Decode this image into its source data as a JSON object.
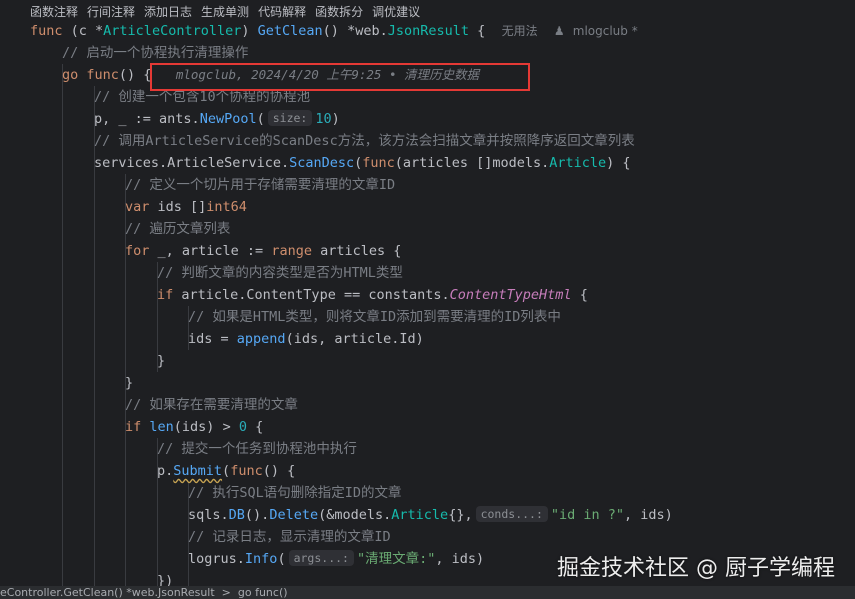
{
  "toolbar": {
    "items": [
      "函数注释",
      "行间注释",
      "添加日志",
      "生成单测",
      "代码解释",
      "函数拆分",
      "调优建议"
    ]
  },
  "code": {
    "l1": {
      "func": "func",
      "recv": "(c *",
      "type": "ArticleController",
      "close": ")",
      "name": "GetClean",
      "paren": "()",
      "star": "*",
      "pkg": "web",
      "dot": ".",
      "rtype": "JsonResult",
      "brace": "{",
      "usage": "无用法",
      "author": "mlogclub *"
    },
    "l2": "// 启动一个协程执行清理操作",
    "l3": {
      "go": "go",
      "func": "func",
      "rest": "() {",
      "blame": "mlogclub, 2024/4/20 上午9:25 • 清理历史数据"
    },
    "l4": "// 创建一个包含10个协程的协程池",
    "l5": {
      "a": "p, _ := ",
      "pkg": "ants",
      "dot": ".",
      "fn": "NewPool",
      "open": "(",
      "hint": "size:",
      "num": "10",
      "close": ")"
    },
    "l6": "// 调用ArticleService的ScanDesc方法，该方法会扫描文章并按照降序返回文章列表",
    "l7": {
      "pkg": "services",
      "dot1": ".",
      "svc": "ArticleService",
      "dot2": ".",
      "fn": "ScanDesc",
      "open": "(",
      "func": "func",
      "args": "(articles []",
      "mpkg": "models",
      "dot3": ".",
      "type": "Article",
      "rest": ") {"
    },
    "l8": "// 定义一个切片用于存储需要清理的文章ID",
    "l9": {
      "var": "var",
      "ids": " ids []",
      "type": "int64"
    },
    "l10": "// 遍历文章列表",
    "l11": {
      "for": "for",
      "mid": " _, article := ",
      "range": "range",
      "rest": " articles {"
    },
    "l12": "// 判断文章的内容类型是否为HTML类型",
    "l13": {
      "if": "if",
      "mid": " article.ContentType == ",
      "pkg": "constants",
      "dot": ".",
      "const": "ContentTypeHtml",
      "rest": " {"
    },
    "l14": "// 如果是HTML类型，则将文章ID添加到需要清理的ID列表中",
    "l15": {
      "a": "ids = ",
      "fn": "append",
      "rest": "(ids, article.Id)"
    },
    "l16": "}",
    "l17": "}",
    "l18": "// 如果存在需要清理的文章",
    "l19": {
      "if": "if",
      "fn": "len",
      "mid": "(ids) > ",
      "num": "0",
      "rest": " {"
    },
    "l20": "// 提交一个任务到协程池中执行",
    "l21": {
      "a": "p.",
      "fn": "Submit",
      "open": "(",
      "func": "func",
      "rest": "() {"
    },
    "l22": "// 执行SQL语句删除指定ID的文章",
    "l23": {
      "pkg": "sqls",
      "dot": ".",
      "fn1": "DB",
      "mid": "().",
      "fn2": "Delete",
      "open": "(&",
      "mpkg": "models",
      "dot2": ".",
      "type": "Article",
      "braces": "{},",
      "hint": "conds...:",
      "str": "\"id in ?\"",
      "rest": ", ids)"
    },
    "l24": "// 记录日志，显示清理的文章ID",
    "l25": {
      "pkg": "logrus",
      "dot": ".",
      "fn": "Info",
      "open": "(",
      "hint": "args...:",
      "str": "\"清理文章:\"",
      "rest": ", ids)"
    },
    "l26": "})"
  },
  "statusbar": "eController.GetClean() *web.JsonResult  >  go func()",
  "watermark": "掘金技术社区 @ 厨子学编程"
}
